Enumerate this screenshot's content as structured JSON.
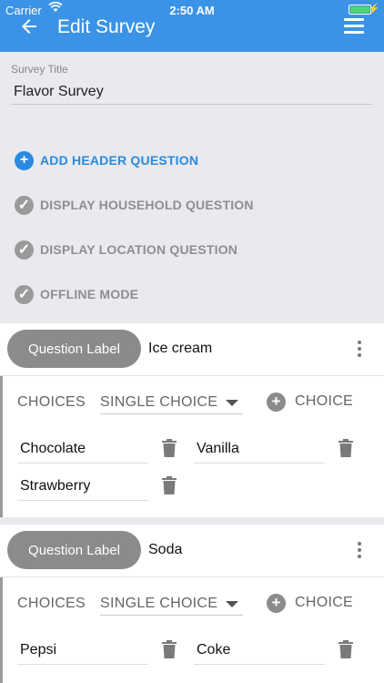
{
  "status_bar": {
    "carrier": "Carrier",
    "time": "2:50 AM"
  },
  "app_bar": {
    "title": "Edit Survey"
  },
  "survey": {
    "title_label": "Survey Title",
    "title_value": "Flavor Survey"
  },
  "options": {
    "add_header": "ADD HEADER QUESTION",
    "household": "DISPLAY HOUSEHOLD QUESTION",
    "location": "DISPLAY LOCATION QUESTION",
    "offline": "OFFLINE MODE"
  },
  "questions": [
    {
      "label_button": "Question Label",
      "text": "Ice cream",
      "choices_label": "CHOICES",
      "type": "SINGLE CHOICE",
      "add_choice_label": "CHOICE",
      "choices": [
        "Chocolate",
        "Vanilla",
        "Strawberry"
      ]
    },
    {
      "label_button": "Question Label",
      "text": "Soda",
      "choices_label": "CHOICES",
      "type": "SINGLE CHOICE",
      "add_choice_label": "CHOICE",
      "choices": [
        "Pepsi",
        "Coke"
      ]
    }
  ],
  "colors": {
    "app_bar": "#3a93e6",
    "accent": "#2a8ae0",
    "muted": "#8b8b8b"
  },
  "icons": [
    "back-arrow-icon",
    "menu-icon",
    "wifi-icon",
    "battery-icon",
    "add-circle-icon",
    "check-circle-icon",
    "more-vert-icon",
    "dropdown-caret-icon",
    "trash-icon"
  ]
}
